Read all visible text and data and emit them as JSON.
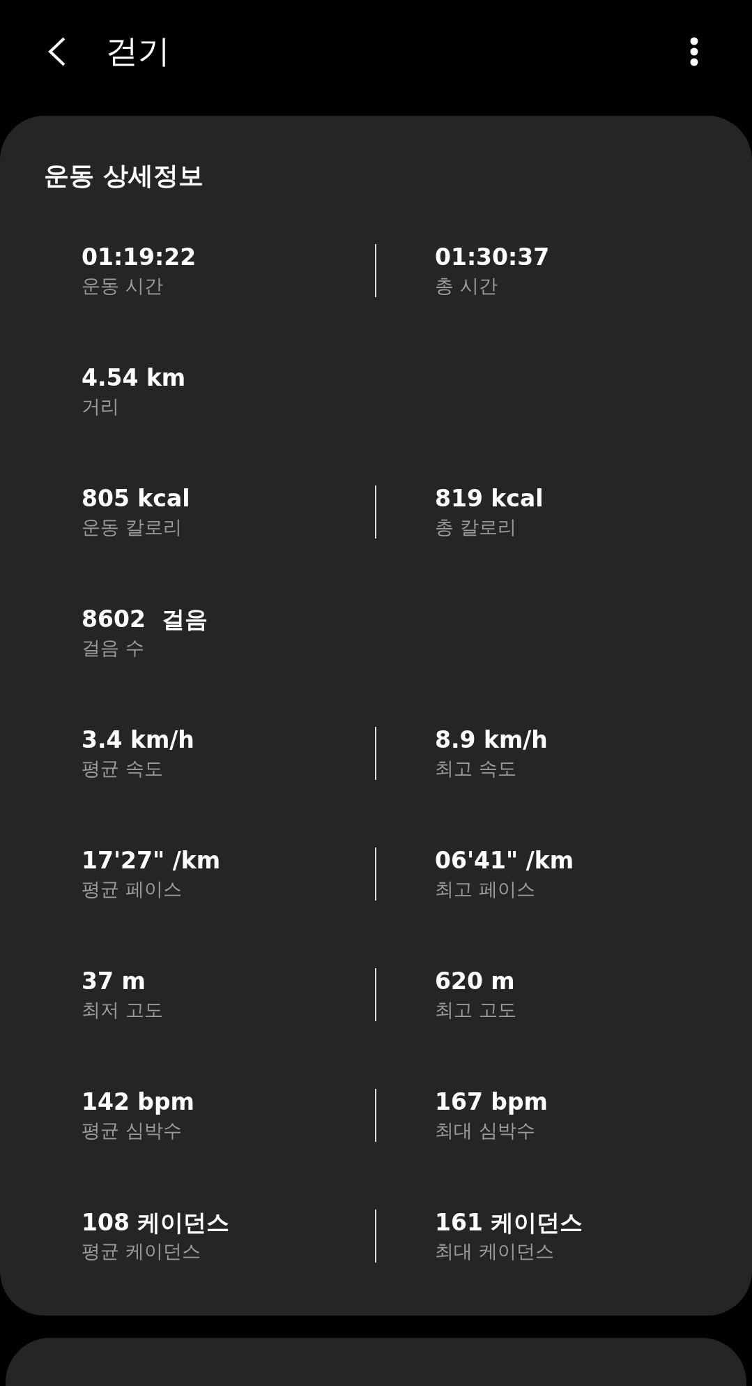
{
  "header": {
    "title": "걷기"
  },
  "details": {
    "title": "운동 상세정보",
    "rows": [
      {
        "left": {
          "value": "01:19:22",
          "label": "운동 시간"
        },
        "right": {
          "value": "01:30:37",
          "label": "총 시간"
        }
      },
      {
        "left": {
          "value": "4.54 km",
          "label": "거리"
        }
      },
      {
        "left": {
          "value": "805 kcal",
          "label": "운동 칼로리"
        },
        "right": {
          "value": "819 kcal",
          "label": "총 칼로리"
        }
      },
      {
        "left": {
          "value": "8602  걸음",
          "label": "걸음 수"
        }
      },
      {
        "left": {
          "value": "3.4 km/h",
          "label": "평균 속도"
        },
        "right": {
          "value": "8.9 km/h",
          "label": "최고 속도"
        }
      },
      {
        "left": {
          "value": "17'27\" /km",
          "label": "평균 페이스"
        },
        "right": {
          "value": "06'41\" /km",
          "label": "최고 페이스"
        }
      },
      {
        "left": {
          "value": "37 m",
          "label": "최저 고도"
        },
        "right": {
          "value": "620 m",
          "label": "최고 고도"
        }
      },
      {
        "left": {
          "value": "142 bpm",
          "label": "평균 심박수"
        },
        "right": {
          "value": "167 bpm",
          "label": "최대 심박수"
        }
      },
      {
        "left": {
          "value": "108 케이던스",
          "label": "평균 케이던스"
        },
        "right": {
          "value": "161 케이던스",
          "label": "최대 케이던스"
        }
      }
    ]
  }
}
